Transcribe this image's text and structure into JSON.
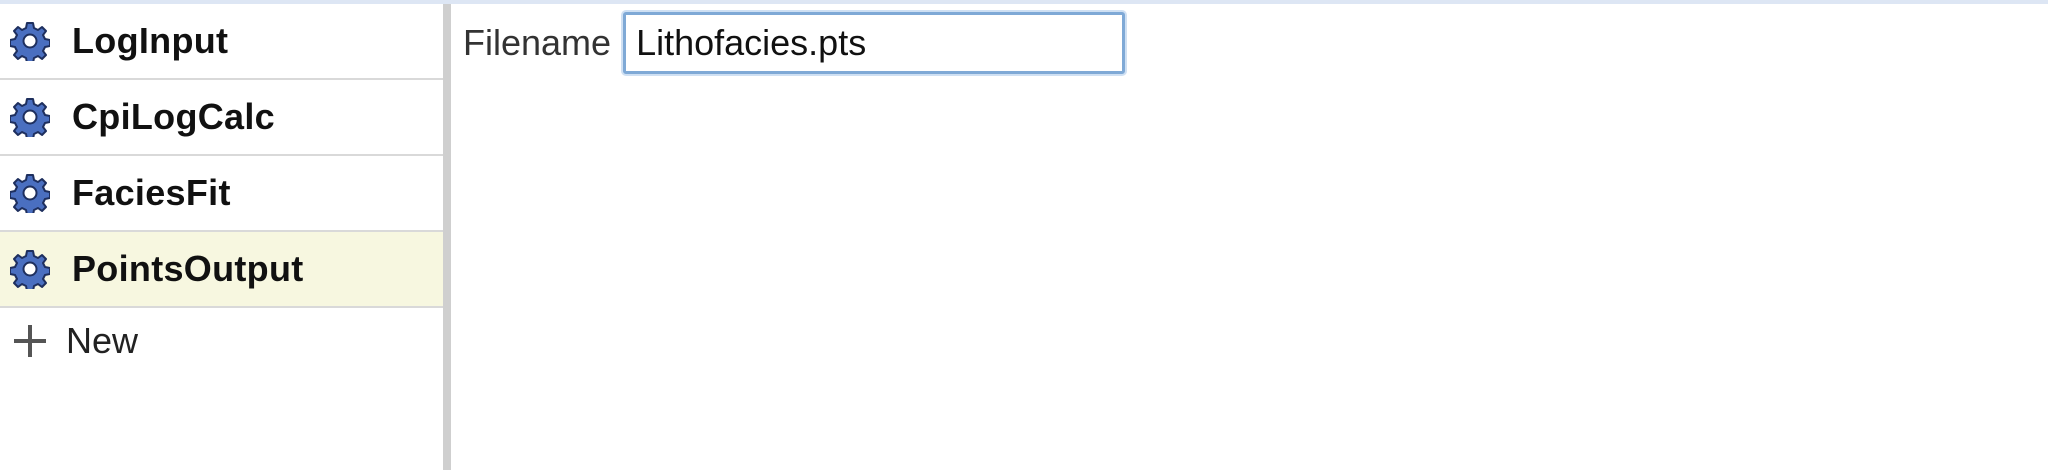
{
  "sidebar": {
    "items": [
      {
        "label": "LogInput",
        "icon": "gear-icon"
      },
      {
        "label": "CpiLogCalc",
        "icon": "gear-icon"
      },
      {
        "label": "FaciesFit",
        "icon": "gear-icon"
      },
      {
        "label": "PointsOutput",
        "icon": "gear-icon",
        "selected": true
      }
    ],
    "new_label": "New",
    "new_icon": "plus-icon"
  },
  "main": {
    "filename_label": "Filename",
    "filename_value": "Lithofacies.pts"
  },
  "colors": {
    "selected_bg": "#f7f7e0",
    "gear_fill": "#4a6fc0",
    "input_border": "#7fa9d6",
    "splitter": "#cfcfcf"
  }
}
